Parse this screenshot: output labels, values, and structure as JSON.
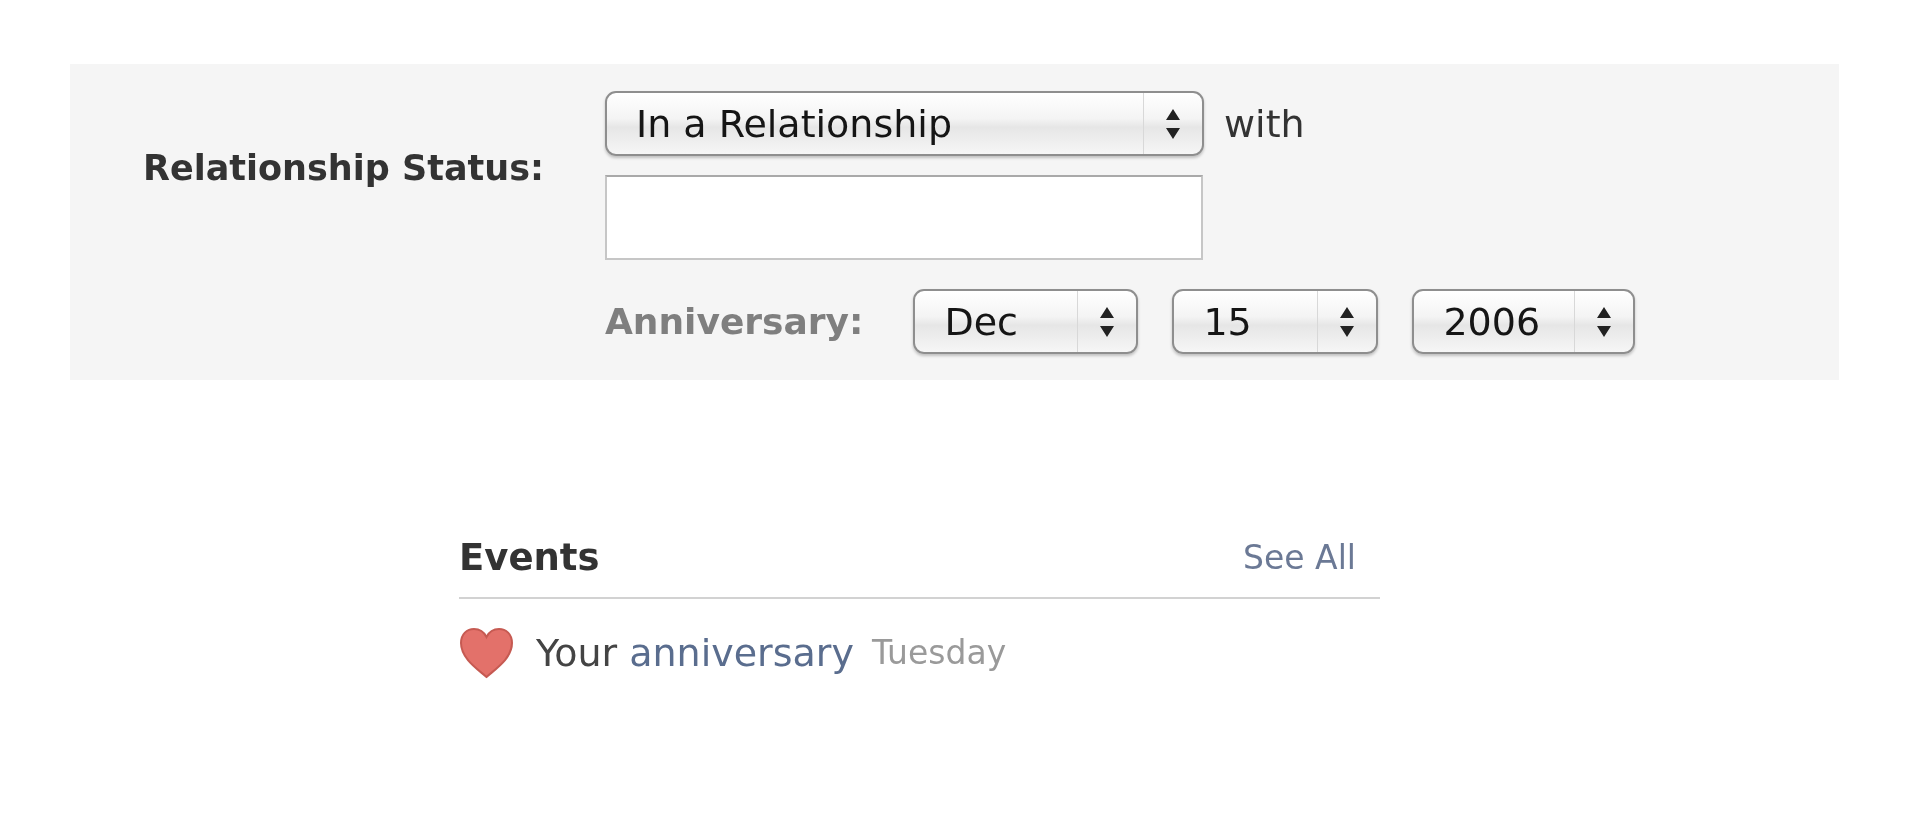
{
  "relationship": {
    "label": "Relationship Status:",
    "status": "In a Relationship",
    "with_label": "with"
  },
  "anniversary": {
    "label": "Anniversary:",
    "selects": [
      "Dec",
      "15",
      "2006"
    ]
  },
  "events": {
    "title": "Events",
    "see_all": "See All",
    "items": [
      {
        "text": "Your",
        "link": "anniversary",
        "when": "Tuesday"
      }
    ]
  }
}
